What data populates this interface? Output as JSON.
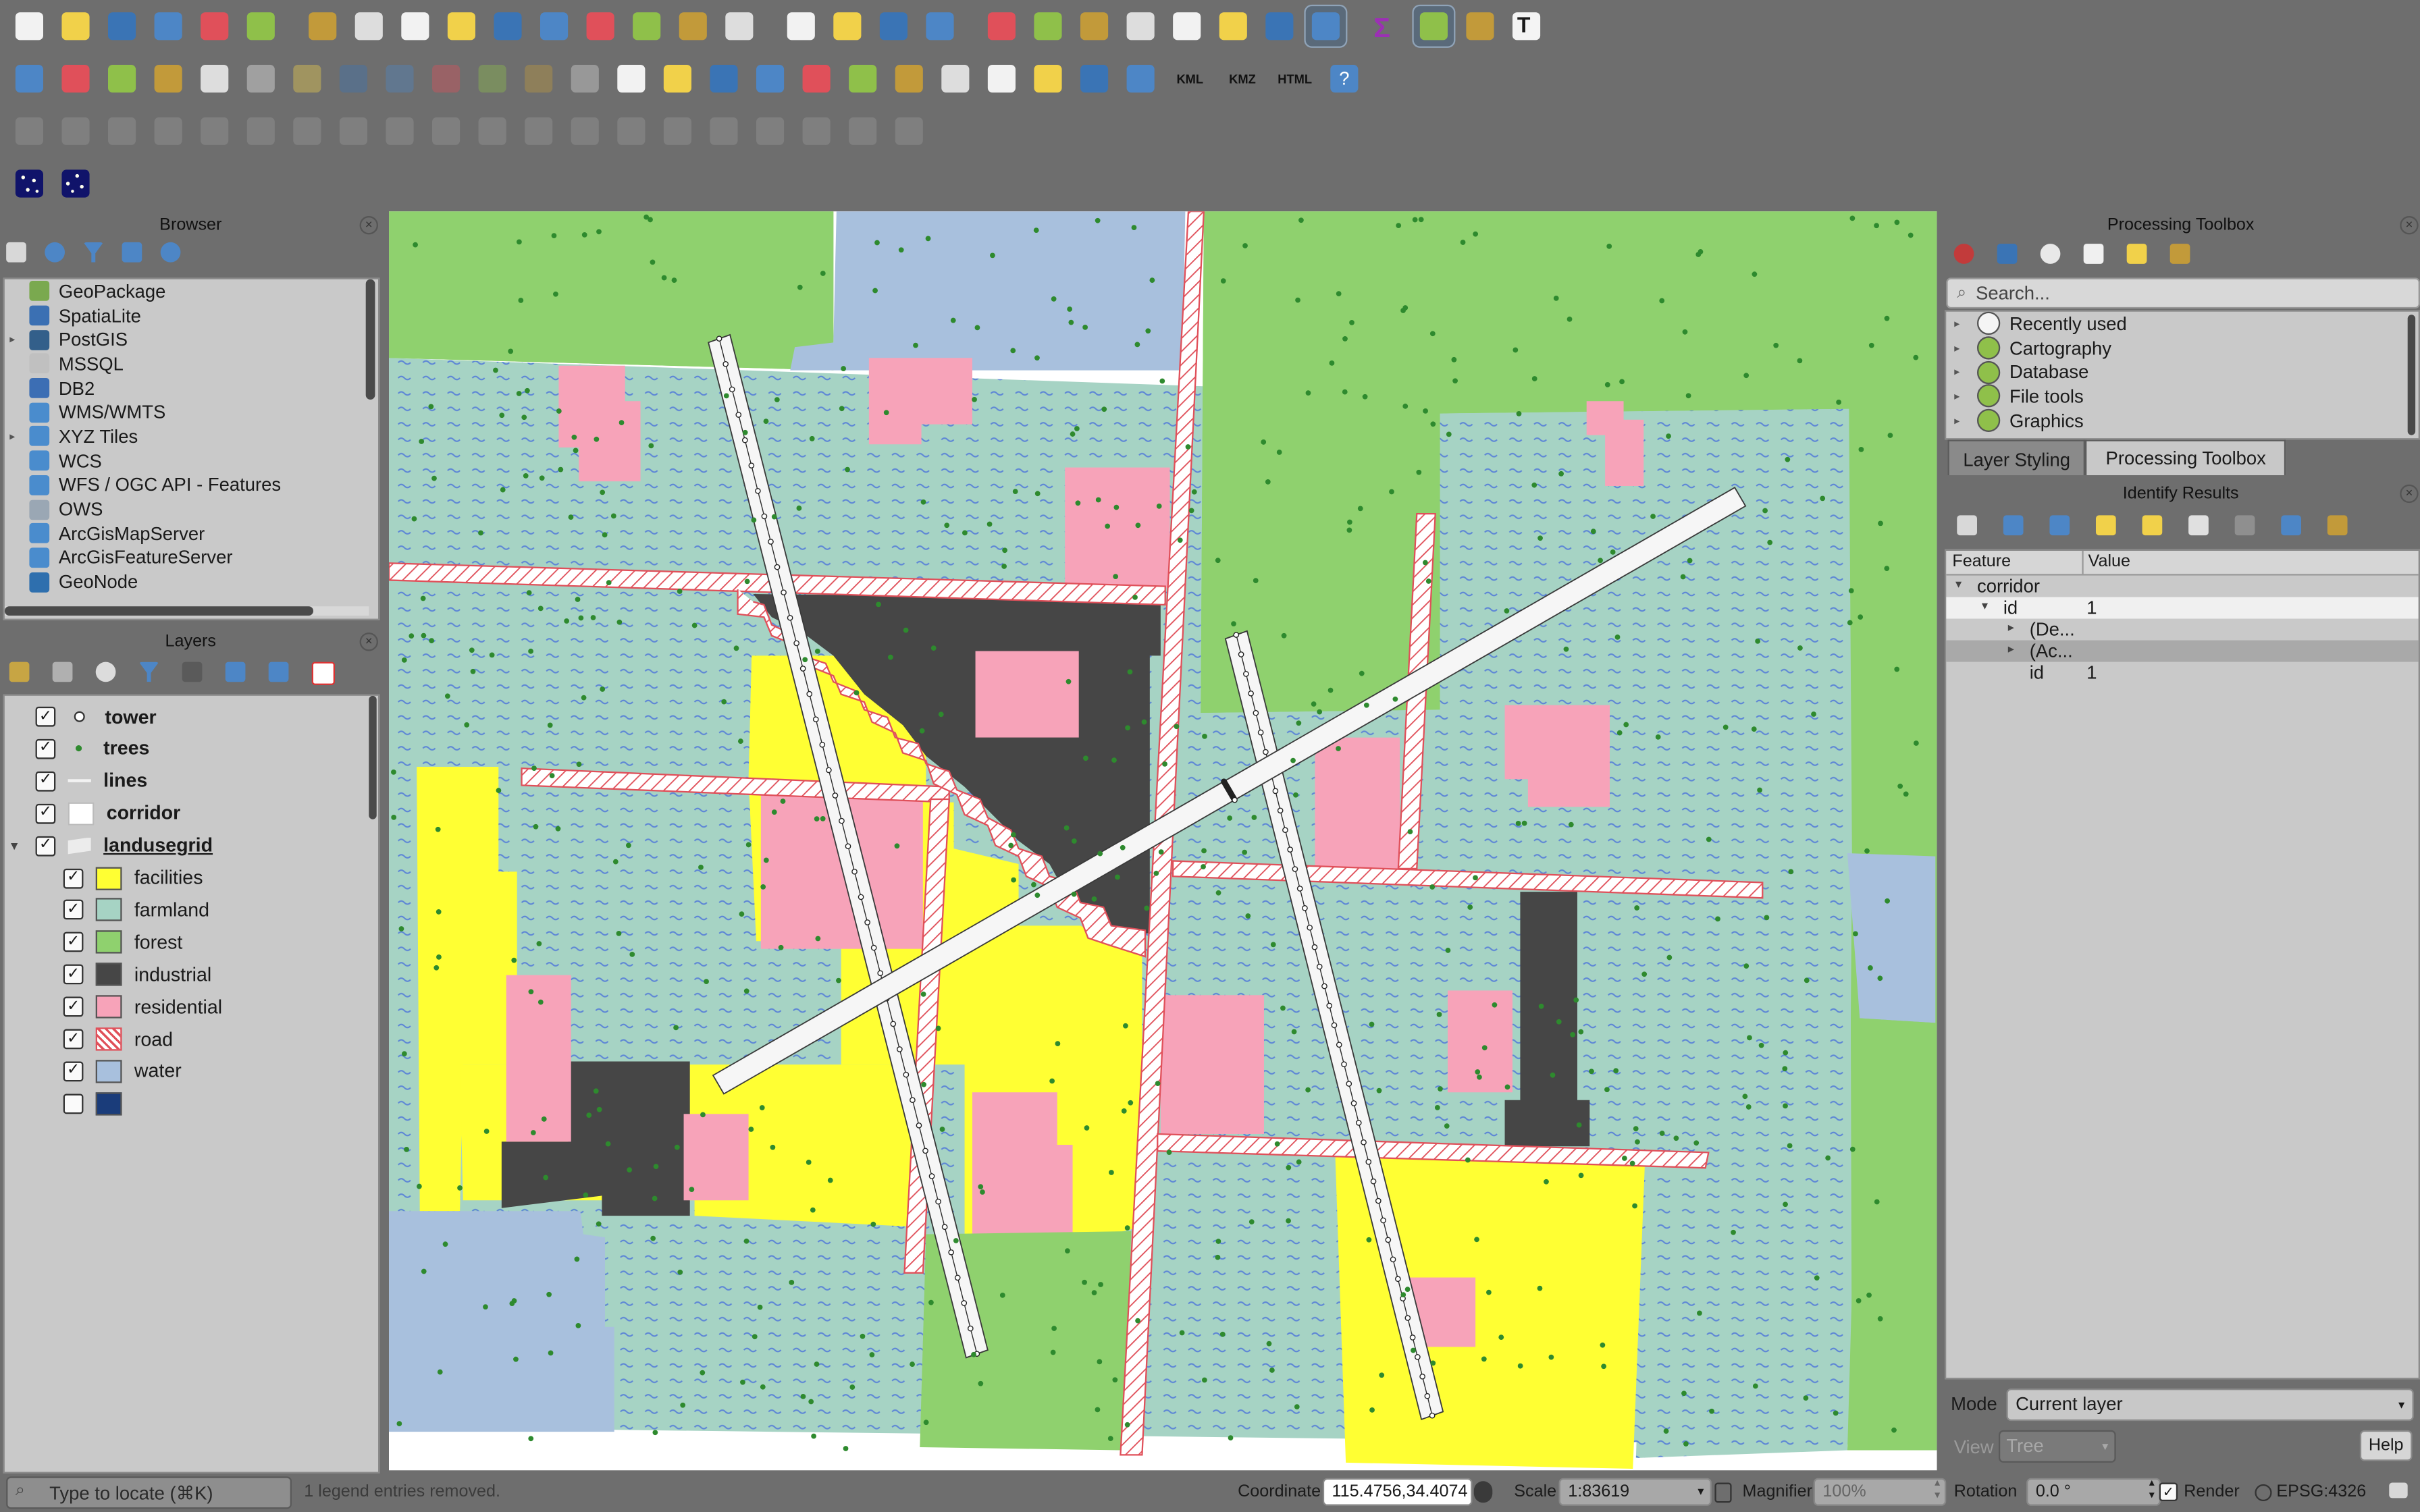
{
  "toolbar": {
    "row1": [
      "new-project",
      "open-project",
      "save-project",
      "save-as",
      "print-layout",
      "style-manager",
      "pan",
      "pan-to-selection",
      "zoom-in",
      "zoom-out",
      "zoom-full",
      "zoom-to-selection",
      "zoom-to-layer",
      "zoom-native",
      "zoom-last",
      "zoom-next",
      "new-bookmark",
      "show-bookmarks",
      "spatial-bookmarks",
      "refresh",
      "identify",
      "actions",
      "select-features",
      "deselect",
      "attribute-table",
      "field-calculator",
      "stats",
      "processing",
      "sum",
      "measure",
      "annotations",
      "text-annotation"
    ],
    "row2_labels": {
      "kml": "KML",
      "kmz": "KMZ",
      "html": "HTML"
    }
  },
  "browser": {
    "title": "Browser",
    "items": [
      {
        "label": "GeoPackage",
        "icon": "geopackage-icon",
        "color": "#7aa94f",
        "expandable": false
      },
      {
        "label": "SpatiaLite",
        "icon": "spatialite-icon",
        "color": "#3b70b3",
        "expandable": false
      },
      {
        "label": "PostGIS",
        "icon": "postgis-icon",
        "color": "#335f8a",
        "expandable": true
      },
      {
        "label": "MSSQL",
        "icon": "mssql-icon",
        "color": "#c0c0c0",
        "expandable": false
      },
      {
        "label": "DB2",
        "icon": "db2-icon",
        "color": "#3c6eb4",
        "expandable": false
      },
      {
        "label": "WMS/WMTS",
        "icon": "wms-icon",
        "color": "#4a8ccd",
        "expandable": false
      },
      {
        "label": "XYZ Tiles",
        "icon": "xyz-tiles-icon",
        "color": "#4a8ccd",
        "expandable": true
      },
      {
        "label": "WCS",
        "icon": "wcs-icon",
        "color": "#4a8ccd",
        "expandable": false
      },
      {
        "label": "WFS / OGC API - Features",
        "icon": "wfs-icon",
        "color": "#4a8ccd",
        "expandable": false
      },
      {
        "label": "OWS",
        "icon": "ows-icon",
        "color": "#9aa7b4",
        "expandable": false
      },
      {
        "label": "ArcGisMapServer",
        "icon": "arcgis-map-icon",
        "color": "#4a8ccd",
        "expandable": false
      },
      {
        "label": "ArcGisFeatureServer",
        "icon": "arcgis-feature-icon",
        "color": "#4a8ccd",
        "expandable": false
      },
      {
        "label": "GeoNode",
        "icon": "geonode-icon",
        "color": "#2e6fae",
        "expandable": false
      }
    ]
  },
  "layers": {
    "title": "Layers",
    "items": [
      {
        "label": "tower",
        "checked": true,
        "symbol": "point-hollow",
        "bold": true,
        "child": false
      },
      {
        "label": "trees",
        "checked": true,
        "symbol": "point-green",
        "bold": true,
        "child": false
      },
      {
        "label": "lines",
        "checked": true,
        "symbol": "line",
        "bold": true,
        "child": false
      },
      {
        "label": "corridor",
        "checked": true,
        "symbol": "white-fill",
        "bold": true,
        "child": false
      },
      {
        "label": "landusegrid",
        "checked": true,
        "symbol": "group",
        "bold": true,
        "child": false
      },
      {
        "label": "facilities",
        "checked": true,
        "symbol": "fill",
        "color": "#ffff33",
        "child": true
      },
      {
        "label": "farmland",
        "checked": true,
        "symbol": "fill",
        "color": "#a6d3c4",
        "child": true
      },
      {
        "label": "forest",
        "checked": true,
        "symbol": "fill",
        "color": "#8fd16e",
        "child": true
      },
      {
        "label": "industrial",
        "checked": true,
        "symbol": "fill",
        "color": "#464646",
        "child": true
      },
      {
        "label": "residential",
        "checked": true,
        "symbol": "fill",
        "color": "#f7a3b9",
        "child": true
      },
      {
        "label": "road",
        "checked": true,
        "symbol": "hatch",
        "color": "#e0505a",
        "child": true
      },
      {
        "label": "water",
        "checked": true,
        "symbol": "fill",
        "color": "#a8c0dd",
        "child": true
      },
      {
        "label": "",
        "checked": false,
        "symbol": "fill",
        "color": "#1a3c7a",
        "child": true
      }
    ]
  },
  "processing": {
    "title": "Processing Toolbox",
    "search_placeholder": "Search...",
    "items": [
      {
        "label": "Recently used",
        "icon": "clock-icon"
      },
      {
        "label": "Cartography",
        "icon": "qgis-icon"
      },
      {
        "label": "Database",
        "icon": "qgis-icon"
      },
      {
        "label": "File tools",
        "icon": "qgis-icon"
      },
      {
        "label": "Graphics",
        "icon": "qgis-icon"
      }
    ]
  },
  "tabs": [
    {
      "label": "Layer Styling",
      "active": false
    },
    {
      "label": "Processing Toolbox",
      "active": true
    }
  ],
  "identify": {
    "title": "Identify Results",
    "columns": [
      "Feature",
      "Value"
    ],
    "rows": [
      {
        "feature": "corridor",
        "value": "",
        "depth": 0,
        "arrow": "▾"
      },
      {
        "feature": "id",
        "value": "1",
        "depth": 1,
        "arrow": "▾",
        "selected": true
      },
      {
        "feature": "(De...",
        "value": "",
        "depth": 2,
        "arrow": "▸"
      },
      {
        "feature": "(Ac...",
        "value": "",
        "depth": 2,
        "arrow": "▸",
        "shaded": true
      },
      {
        "feature": "id",
        "value": "1",
        "depth": 2,
        "arrow": ""
      }
    ],
    "mode_label": "Mode",
    "mode_value": "Current layer",
    "view_label": "View",
    "view_value": "Tree",
    "help_label": "Help"
  },
  "statusbar": {
    "locator_placeholder": "Type to locate (⌘K)",
    "message": "1 legend entries removed.",
    "coordinate_label": "Coordinate",
    "coordinate_value": "115.4756,34.4074",
    "scale_label": "Scale",
    "scale_value": "1:83619",
    "magnifier_label": "Magnifier",
    "magnifier_value": "100%",
    "rotation_label": "Rotation",
    "rotation_value": "0.0 °",
    "render_label": "Render",
    "crs": "EPSG:4326"
  },
  "map_colors": {
    "forest": "#8fd16e",
    "farmland": "#a6d3c4",
    "facilities": "#ffff33",
    "industrial": "#464646",
    "residential": "#f7a3b9",
    "water": "#a8c0dd",
    "road": "#e0505a",
    "tree": "#2e8a2e"
  }
}
